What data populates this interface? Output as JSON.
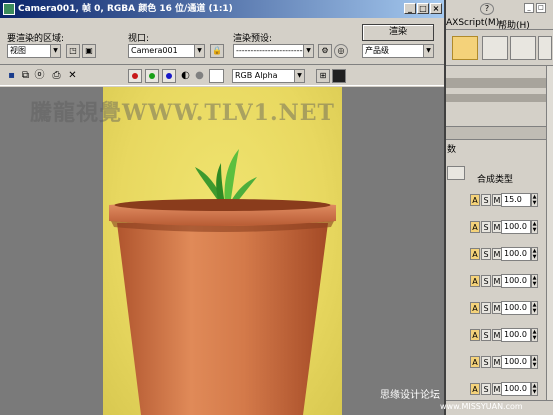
{
  "render_window": {
    "title": "Camera001, 帧 0, RGBA 颜色 16 位/通道 (1:1)",
    "area_label": "要渲染的区域:",
    "area_value": "视图",
    "viewport_label": "视口:",
    "viewport_value": "Camera001",
    "preset_label": "渲染预设:",
    "preset_value": "--------------------------",
    "render_button": "渲染",
    "product_value": "产品级",
    "channel_value": "RGB Alpha",
    "buttons": {
      "minimize": "_",
      "maximize": "□",
      "close": "×"
    }
  },
  "watermark": "騰龍視覺WWW.TLV1.NET",
  "corner_watermark": "思缘设计论坛",
  "corner_watermark_small": "www.MISSYUAN.com",
  "background_app": {
    "menu": [
      "AXScript(M)",
      "帮助(H)"
    ],
    "panel_tab": "数",
    "composite_label": "合成类型",
    "rows": [
      {
        "value": "15.0"
      },
      {
        "value": "100.0"
      },
      {
        "value": "100.0"
      },
      {
        "value": "100.0"
      },
      {
        "value": "100.0"
      },
      {
        "value": "100.0"
      },
      {
        "value": "100.0"
      },
      {
        "value": "100.0"
      }
    ],
    "row_buttons": [
      "A",
      "S",
      "M"
    ]
  },
  "colors": {
    "title_start": "#0a246a",
    "title_end": "#a6caf0",
    "pot": "#d47a4a",
    "wall": "#e8d860",
    "leaf": "#4cae3c"
  }
}
